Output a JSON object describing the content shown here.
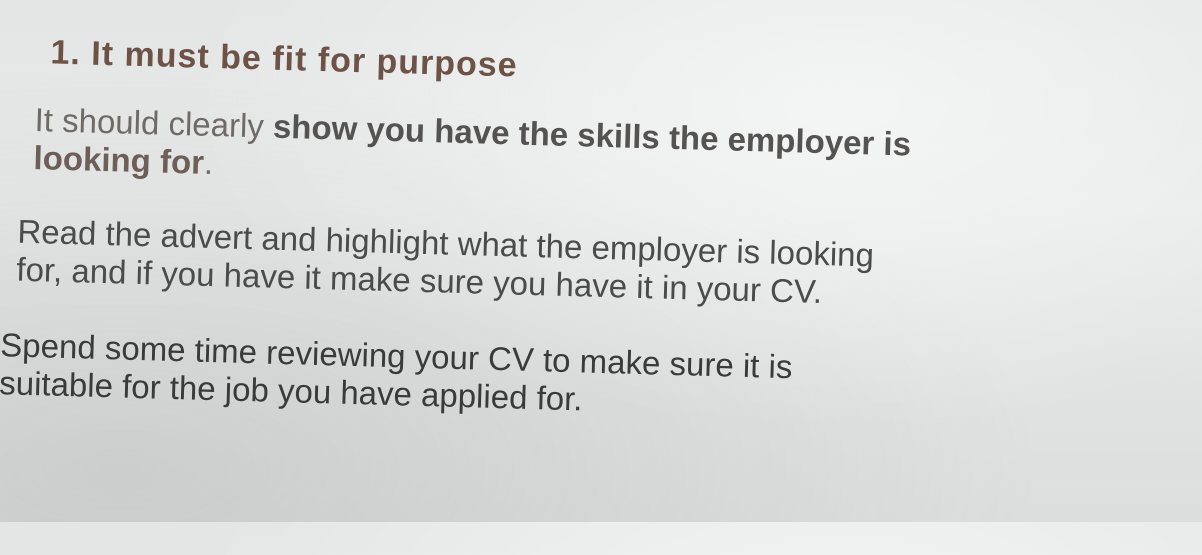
{
  "heading": "1. It must be fit for purpose",
  "para1": {
    "line1_a": "It should clearly ",
    "line1_b": "show you have the skills the employer is",
    "line2_a": "looking for",
    "line2_b": "."
  },
  "para2": {
    "line1": "Read the advert and highlight what the employer is looking",
    "line2": "for, and if you have it make sure you have it in your CV."
  },
  "para3": {
    "line1": "Spend some time reviewing your CV to make sure it is",
    "line2": "suitable for the job you have applied for."
  }
}
